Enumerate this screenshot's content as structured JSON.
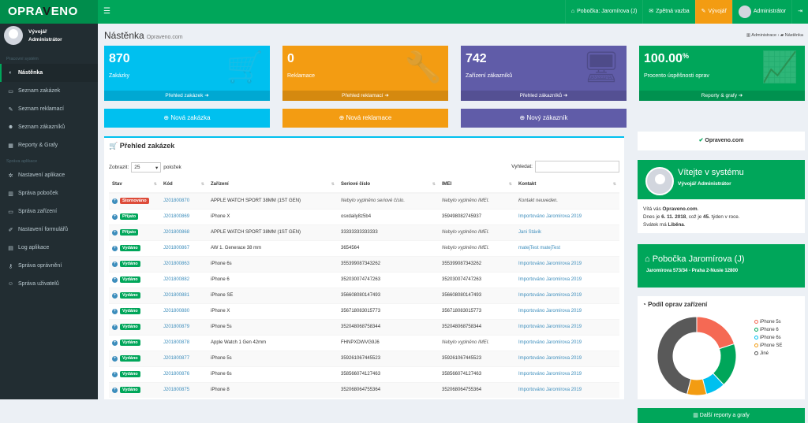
{
  "app": {
    "logo_a": "OPRA",
    "logo_b": "V",
    "logo_c": "ENO"
  },
  "topnav": {
    "branch": "Pobočka: Jaromírova (J)",
    "feedback": "Zpětná vazba",
    "developer": "Vývojář",
    "user": "Administrátor"
  },
  "sidebar": {
    "user_line1": "Vývojář",
    "user_line2": "Administrátor",
    "section1": "Pracovní systém",
    "items1": [
      {
        "label": "Nástěnka",
        "icon": "dashboard-icon"
      },
      {
        "label": "Seznam zakázek",
        "icon": "folder-icon"
      },
      {
        "label": "Seznam reklamací",
        "icon": "wrench-icon"
      },
      {
        "label": "Seznam zákazníků",
        "icon": "users-icon"
      },
      {
        "label": "Reporty & Grafy",
        "icon": "chart-icon"
      }
    ],
    "section2": "Správa aplikace",
    "items2": [
      {
        "label": "Nastavení aplikace",
        "icon": "cogs-icon"
      },
      {
        "label": "Správa poboček",
        "icon": "building-icon"
      },
      {
        "label": "Správa zařízení",
        "icon": "monitor-icon"
      },
      {
        "label": "Nastavení formulářů",
        "icon": "edit-icon"
      },
      {
        "label": "Log aplikace",
        "icon": "file-icon"
      },
      {
        "label": "Správa oprávnění",
        "icon": "key-icon"
      },
      {
        "label": "Správa uživatelů",
        "icon": "user-icon"
      }
    ]
  },
  "page": {
    "title": "Nástěnka",
    "subtitle": "Opraveno.com",
    "bread1": "Administrace",
    "bread2": "Nástěnka"
  },
  "stats": [
    {
      "num": "870",
      "label": "Zakázky",
      "foot": "Přehled zakázek",
      "color": "#00c0ef",
      "icon": "cart-icon"
    },
    {
      "num": "0",
      "label": "Reklamace",
      "foot": "Přehled reklamací",
      "color": "#f39c12",
      "icon": "wrench-icon"
    },
    {
      "num": "742",
      "label": "Zařízení zákazníků",
      "foot": "Přehled zákazníků",
      "color": "#605ca8",
      "icon": "monitor-icon"
    },
    {
      "num": "100.00",
      "sup": "%",
      "label": "Procento úspěšnosti oprav",
      "foot": "Reporty & grafy",
      "color": "#00a65a",
      "icon": "chart-icon"
    }
  ],
  "actions": [
    {
      "label": "Nová zakázka",
      "color": "#00c0ef"
    },
    {
      "label": "Nová reklamace",
      "color": "#f39c12"
    },
    {
      "label": "Nový zákazník",
      "color": "#605ca8"
    }
  ],
  "sponsor": "Opraveno.com",
  "orders": {
    "title": "Přehled zakázek",
    "show_label": "Zobrazit:",
    "show_value": "25",
    "show_suffix": "položek",
    "search_label": "Vyhledat:",
    "columns": [
      "Stav",
      "Kód",
      "Zařízení",
      "Seriové číslo",
      "IMEI",
      "Kontakt"
    ],
    "rows": [
      {
        "status": "Stornováno",
        "type": "storno",
        "code": "J201800870",
        "device": "APPLE WATCH SPORT 38MM (1ST GEN)",
        "serial": "Nebylo vyplněno seriové číslo.",
        "serial_i": true,
        "imei": "Nebylo vyplněno IMEI.",
        "imei_i": true,
        "contact": "Kontakt neuveden.",
        "contact_i": true
      },
      {
        "status": "Přijato",
        "type": "prijato",
        "code": "J201800869",
        "device": "iPhone X",
        "serial": "osxdaily8z5b4",
        "imei": "359498082745937",
        "contact": "Importováno Jaromírova 2019",
        "link": true
      },
      {
        "status": "Přijato",
        "type": "prijato",
        "code": "J201800868",
        "device": "APPLE WATCH SPORT 38MM (1ST GEN)",
        "serial": "33333333333333",
        "imei": "Nebylo vyplněno IMEI.",
        "imei_i": true,
        "contact": "Jani Stávik",
        "link": true
      },
      {
        "status": "Vydáno",
        "type": "vydano",
        "code": "J201800867",
        "device": "AW 1. Generace 38 mm",
        "serial": "3654564",
        "imei": "Nebylo vyplněno IMEI.",
        "imei_i": true,
        "contact": "matejTest matejTest",
        "link": true
      },
      {
        "status": "Vydáno",
        "type": "vydano",
        "code": "J201800863",
        "device": "iPhone 6s",
        "serial": "355399087343262",
        "imei": "355399087343262",
        "contact": "Importováno Jaromírova 2019",
        "link": true
      },
      {
        "status": "Vydáno",
        "type": "vydano",
        "code": "J201800882",
        "device": "iPhone 6",
        "serial": "352030074747263",
        "imei": "352030074747263",
        "contact": "Importováno Jaromírova 2019",
        "link": true
      },
      {
        "status": "Vydáno",
        "type": "vydano",
        "code": "J201800881",
        "device": "iPhone SE",
        "serial": "356608080147493",
        "imei": "356608080147493",
        "contact": "Importováno Jaromírova 2019",
        "link": true
      },
      {
        "status": "Vydáno",
        "type": "vydano",
        "code": "J201800880",
        "device": "iPhone X",
        "serial": "356718083015773",
        "imei": "356718083015773",
        "contact": "Importováno Jaromírova 2019",
        "link": true
      },
      {
        "status": "Vydáno",
        "type": "vydano",
        "code": "J201800879",
        "device": "iPhone 5s",
        "serial": "352048068758344",
        "imei": "352048068758344",
        "contact": "Importováno Jaromírova 2019",
        "link": true
      },
      {
        "status": "Vydáno",
        "type": "vydano",
        "code": "J201800878",
        "device": "Apple Watch 1 Gen 42mm",
        "serial": "FHNPXDWVG9J6",
        "imei": "Nebylo vyplněno IMEI.",
        "imei_i": true,
        "contact": "Importováno Jaromírova 2019",
        "link": true
      },
      {
        "status": "Vydáno",
        "type": "vydano",
        "code": "J201800877",
        "device": "iPhone 5s",
        "serial": "359261067445523",
        "imei": "359261067445523",
        "contact": "Importováno Jaromírova 2019",
        "link": true
      },
      {
        "status": "Vydáno",
        "type": "vydano",
        "code": "J201800876",
        "device": "iPhone 6s",
        "serial": "358566074127463",
        "imei": "358566074127463",
        "contact": "Importováno Jaromírova 2019",
        "link": true
      },
      {
        "status": "Vydáno",
        "type": "vydano",
        "code": "J201800875",
        "device": "iPhone 8",
        "serial": "352068064755364",
        "imei": "352068064755364",
        "contact": "Importováno Jaromírova 2019",
        "link": true
      }
    ]
  },
  "welcome": {
    "title": "Vítejte v systému",
    "sub": "Vývojář Administrátor",
    "l1a": "Vítá vás ",
    "l1b": "Opraveno.com",
    "l1c": ".",
    "l2a": "Dnes je ",
    "l2b": "6. 11. 2018",
    "l2c": ", což je ",
    "l2d": "45.",
    "l2e": " týden v roce.",
    "l3a": "Svátek má ",
    "l3b": "Liběna",
    "l3c": "."
  },
  "branch": {
    "name": "Pobočka Jaromírova (J)",
    "address": "Jaromírova 573/34 - Praha 2-Nusle 12800"
  },
  "chart_data": {
    "type": "pie",
    "title": "Podíl oprav zařízení",
    "categories": [
      "iPhone 5s",
      "iPhone 6",
      "iPhone 6s",
      "iPhone SE",
      "Jiné"
    ],
    "values": [
      20,
      18,
      8,
      8,
      46
    ],
    "colors": [
      "#f56954",
      "#00a65a",
      "#00c0ef",
      "#f39c12",
      "#595959"
    ]
  },
  "more": "Další reporty a grafy"
}
